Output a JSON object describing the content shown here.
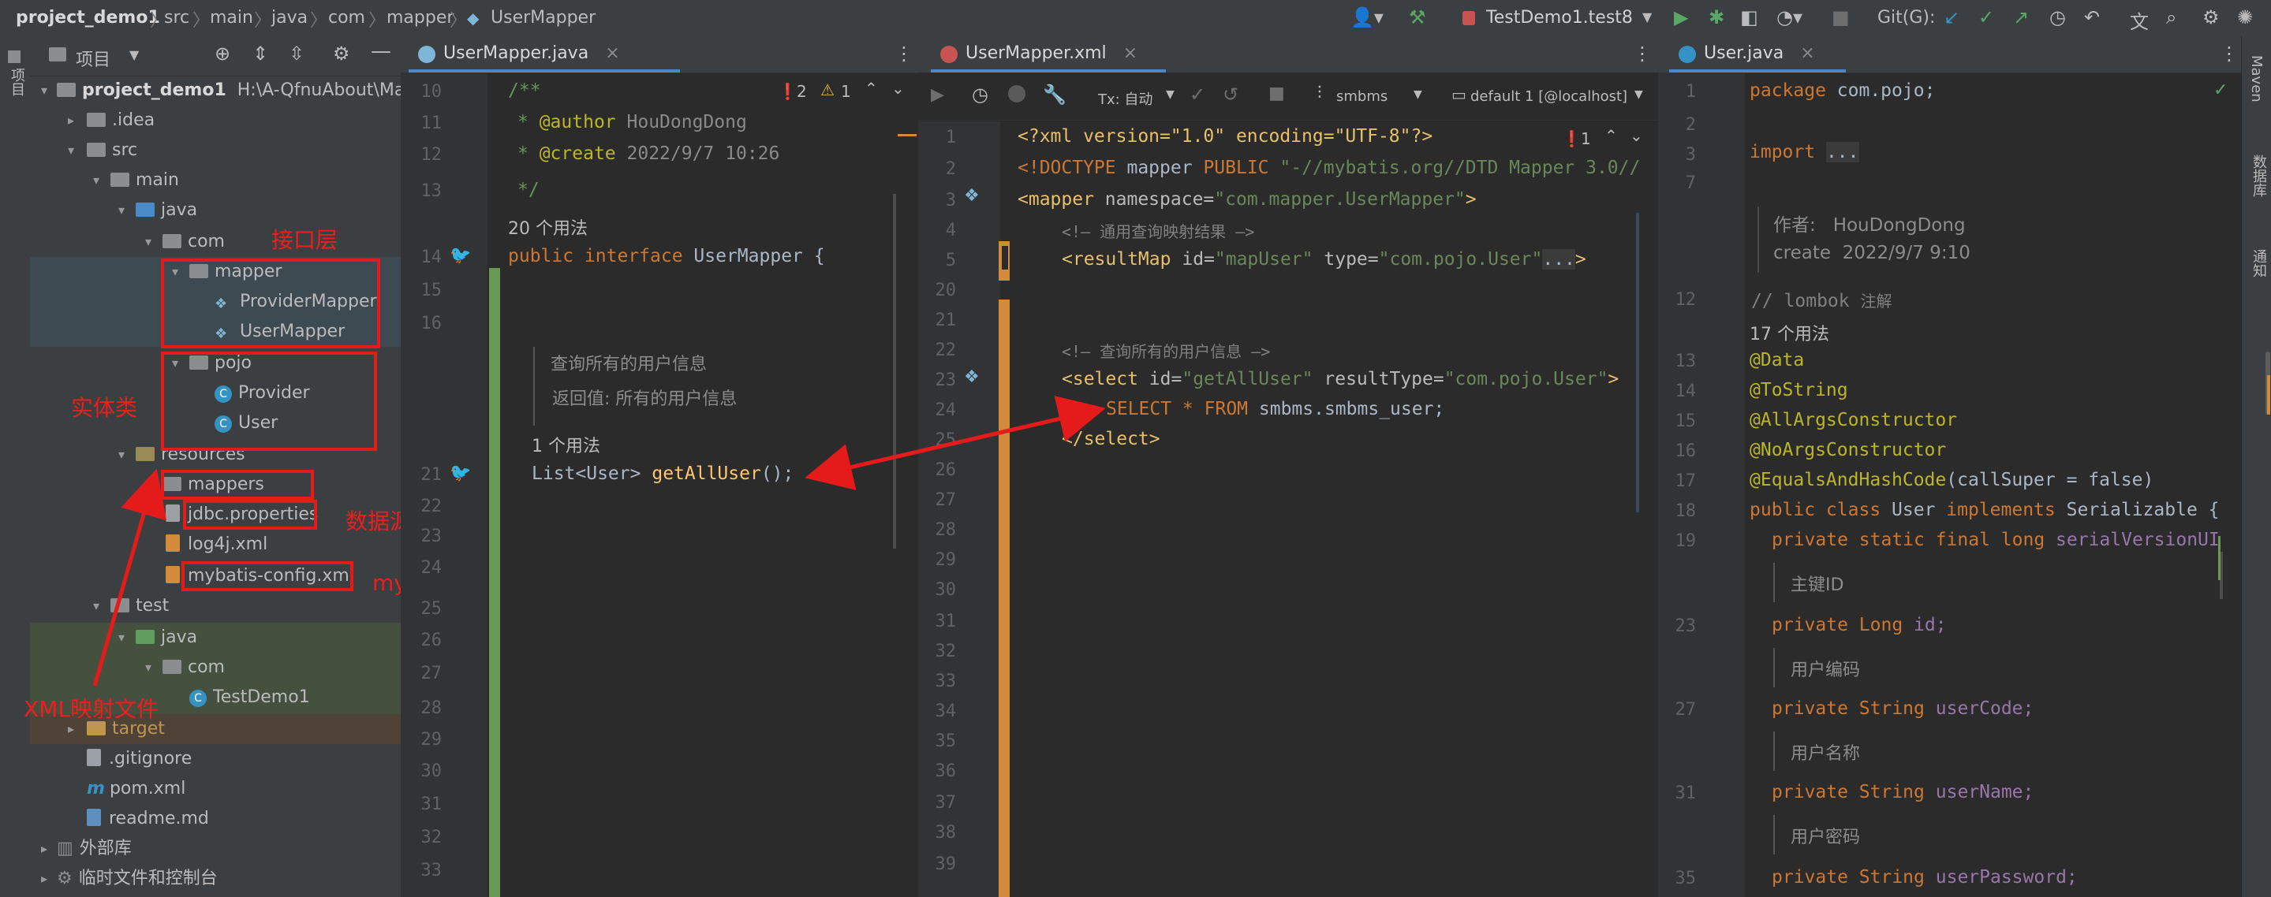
{
  "breadcrumb": [
    "project_demo1",
    "src",
    "main",
    "java",
    "com",
    "mapper",
    "UserMapper"
  ],
  "run_config": "TestDemo1.test8",
  "git_label": "Git(G):",
  "left_strip_label": "项目",
  "right_strip": [
    "Maven",
    "数据库",
    "通知"
  ],
  "project_panel": {
    "title": "项目",
    "tree": {
      "root": "project_demo1",
      "root_path": "H:\\A-QfnuAbout\\Major",
      "idea": ".idea",
      "src": "src",
      "main": "main",
      "java": "java",
      "com": "com",
      "mapper": "mapper",
      "provider_mapper": "ProviderMapper",
      "user_mapper": "UserMapper",
      "pojo": "pojo",
      "provider": "Provider",
      "user": "User",
      "resources": "resources",
      "mappers": "mappers",
      "jdbc": "jdbc.properties",
      "log4j": "log4j.xml",
      "mybatis_config": "mybatis-config.xml",
      "test": "test",
      "test_java": "java",
      "test_com": "com",
      "test_demo": "TestDemo1",
      "target": "target",
      "gitignore": ".gitignore",
      "pom": "pom.xml",
      "readme": "readme.md",
      "external_libs": "外部库",
      "scratches": "临时文件和控制台"
    },
    "annotations": {
      "interface_layer": "接口层",
      "entity": "实体类",
      "datasource": "数据源配置",
      "mybatis_config": "mybatis 配置文件",
      "xml_mapping": "XML映射文件"
    }
  },
  "editor1": {
    "tab": "UserMapper.java",
    "errors": "2",
    "warnings": "1",
    "lines": {
      "l10": "10",
      "l11": "11",
      "l12": "12",
      "l13": "13",
      "l14": "14",
      "l15": "15",
      "l16": "16",
      "l21": "21",
      "l22": "22",
      "l23": "23",
      "l24": "24",
      "l25": "25",
      "l26": "26",
      "l27": "27",
      "l28": "28",
      "l29": "29",
      "l30": "30",
      "l31": "31",
      "l32": "32",
      "l33": "33"
    },
    "code": {
      "c10": "/**",
      "c11_a": "@author",
      "c11_b": "HouDongDong",
      "c12_a": "@create",
      "c12_b": "2022/9/7 10:26",
      "c13": "*/",
      "usage20": "20 个用法",
      "c14_kw": "public interface",
      "c14_name": "UserMapper",
      "c14_brace": "{",
      "doc1": "查询所有的用户信息",
      "doc2": "返回值: 所有的用户信息",
      "usage1": "1 个用法",
      "c21_type": "List<User>",
      "c21_fn": "getAllUser",
      "c21_end": "();"
    }
  },
  "editor2": {
    "tab": "UserMapper.xml",
    "toolbar": {
      "tx": "Tx: 自动",
      "schema": "smbms",
      "datasource": "default 1 [@localhost]"
    },
    "errors": "1",
    "lines": {
      "l1": "1",
      "l2": "2",
      "l3": "3",
      "l4": "4",
      "l5": "5",
      "l20": "20",
      "l21": "21",
      "l22": "22",
      "l23": "23",
      "l24": "24",
      "l25": "25",
      "l26": "26",
      "l27": "27",
      "l28": "28",
      "l29": "29",
      "l30": "30",
      "l31": "31",
      "l32": "32",
      "l33": "33",
      "l34": "34",
      "l35": "35",
      "l36": "36",
      "l37": "37",
      "l38": "38",
      "l39": "39"
    },
    "code": {
      "x1": "<?xml version=\"1.0\" encoding=\"UTF-8\"?>",
      "x2_a": "<!DOCTYPE",
      "x2_b": "mapper",
      "x2_c": "PUBLIC",
      "x2_d": "\"-//mybatis.org//DTD Mapper 3.0//",
      "x3_tag": "<mapper",
      "x3_attr": "namespace=",
      "x3_val": "\"com.mapper.UserMapper\"",
      "x3_end": ">",
      "x4": "<!— 通用查询映射结果 —>",
      "x5_tag": "<resultMap",
      "x5_attr1": "id=",
      "x5_val1": "\"mapUser\"",
      "x5_attr2": "type=",
      "x5_val2": "\"com.pojo.User\"",
      "x5_fold": "...",
      "x5_end": ">",
      "x22": "<!—   查询所有的用户信息   —>",
      "x23_tag": "<select",
      "x23_attr1": "id=",
      "x23_val1": "\"getAllUser\"",
      "x23_attr2": "resultType=",
      "x23_val2": "\"com.pojo.User\"",
      "x23_end": ">",
      "x24_kw": "SELECT * FROM",
      "x24_tbl": "smbms.smbms_user;",
      "x25": "</select>"
    }
  },
  "editor3": {
    "tab": "User.java",
    "lines": {
      "l1": "1",
      "l2": "2",
      "l3": "3",
      "l7": "7",
      "l12": "12",
      "l13": "13",
      "l14": "14",
      "l15": "15",
      "l16": "16",
      "l17": "17",
      "l18": "18",
      "l19": "19",
      "l23": "23",
      "l27": "27",
      "l31": "31",
      "l35": "35"
    },
    "code": {
      "p1_kw": "package",
      "p1_name": "com.pojo;",
      "p3_kw": "import",
      "p3_fold": "...",
      "doc_author_label": "作者:",
      "doc_author": "HouDongDong",
      "doc_create_label": "create",
      "doc_create": "2022/9/7 9:10",
      "c12": "// lombok",
      "c12_hint": "注解",
      "usage17": "17 个用法",
      "a13": "@Data",
      "a14": "@ToString",
      "a15": "@AllArgsConstructor",
      "a16": "@NoArgsConstructor",
      "a17": "@EqualsAndHashCode",
      "a17_args": "(callSuper = false)",
      "c18_kw": "public class",
      "c18_name": "User",
      "c18_impl": "implements",
      "c18_iface": "Serializable",
      "c18_brace": "{",
      "c19_kw": "private static final long",
      "c19_name": "serialVersionUI",
      "d_pk": "主键ID",
      "c23_kw": "private",
      "c23_type": "Long",
      "c23_name": "id;",
      "d_code": "用户编码",
      "c27_kw": "private",
      "c27_type": "String",
      "c27_name": "userCode;",
      "d_name": "用户名称",
      "c31_kw": "private",
      "c31_type": "String",
      "c31_name": "userName;",
      "d_pwd": "用户密码",
      "c35_kw": "private",
      "c35_type": "String",
      "c35_name": "userPassword;"
    }
  },
  "colors": {
    "accent_red": "#e51b1b",
    "tab_underline": "#4a88c7",
    "gutter_green": "#6a9955"
  }
}
